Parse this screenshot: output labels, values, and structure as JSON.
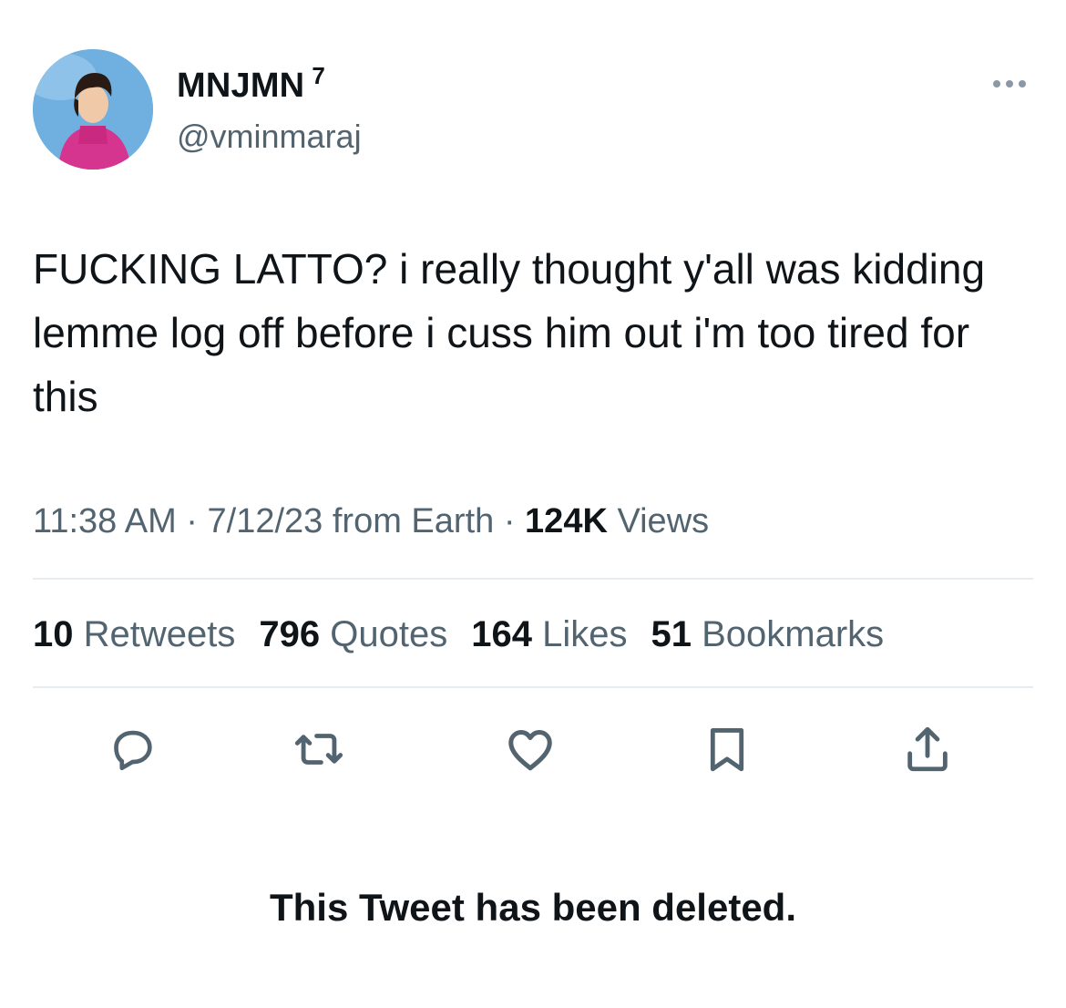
{
  "author": {
    "display_name": "MNJMN",
    "name_badge": "7",
    "handle": "@vminmaraj"
  },
  "tweet": {
    "text": "FUCKING LATTO? i really thought y'all was kidding lemme log off before i cuss him out i'm too tired for this"
  },
  "meta": {
    "time": "11:38 AM",
    "separator": "·",
    "date": "7/12/23",
    "source": "from Earth",
    "views_count": "124K",
    "views_label": "Views"
  },
  "stats": {
    "retweets_count": "10",
    "retweets_label": "Retweets",
    "quotes_count": "796",
    "quotes_label": "Quotes",
    "likes_count": "164",
    "likes_label": "Likes",
    "bookmarks_count": "51",
    "bookmarks_label": "Bookmarks"
  },
  "actions": [
    {
      "icon": "reply-icon"
    },
    {
      "icon": "retweet-icon"
    },
    {
      "icon": "like-icon"
    },
    {
      "icon": "bookmark-icon"
    },
    {
      "icon": "share-icon"
    }
  ],
  "notice": {
    "text": "This Tweet has been deleted."
  },
  "colors": {
    "primary_text": "#0f1419",
    "secondary_text": "#536471",
    "divider": "#e6ecf0",
    "icon": "#536471"
  }
}
